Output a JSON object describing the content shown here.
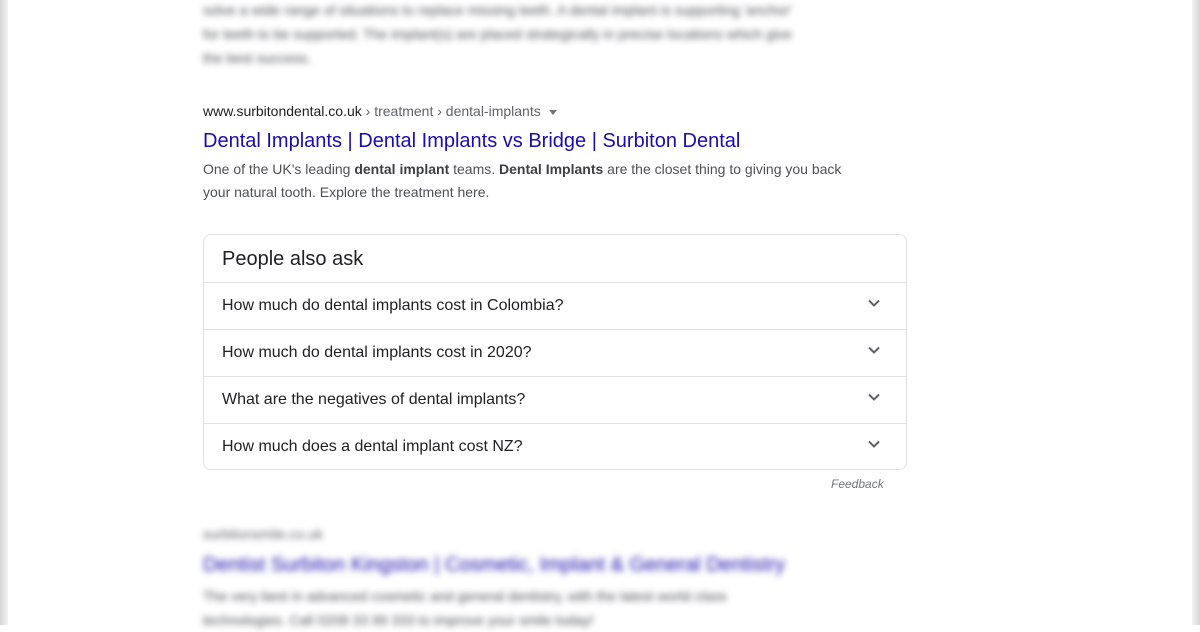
{
  "top_snippet": {
    "line1": "solve a wide range of situations to replace missing teeth. A dental implant is supporting 'anchor'",
    "line2": "for teeth to be supported. The implant(s) are placed strategically in precise locations which give",
    "line3": "the best success."
  },
  "result": {
    "domain": "www.surbitondental.co.uk",
    "crumbs": " › treatment › dental-implants",
    "title": "Dental Implants | Dental Implants vs Bridge | Surbiton Dental",
    "snippet_1": "One of the UK's leading ",
    "snippet_b1": "dental implant",
    "snippet_2": " teams. ",
    "snippet_b2": "Dental Implants",
    "snippet_3": " are the closet thing to giving you back your natural tooth. Explore the treatment here."
  },
  "people_also_ask": {
    "heading": "People also ask",
    "questions": [
      "How much do dental implants cost in Colombia?",
      "How much do dental implants cost in 2020?",
      "What are the negatives of dental implants?",
      "How much does a dental implant cost NZ?"
    ],
    "feedback": "Feedback"
  },
  "bottom_result": {
    "cite": "surbitonsmile.co.uk",
    "title": "Dentist Surbiton Kingston | Cosmetic, Implant & General Dentistry",
    "snippet_line1": "The very best in advanced cosmetic and general dentistry, with the latest world class",
    "snippet_line2": "technologies. Call 0208 33 99 333 to improve your smile today!"
  },
  "colors": {
    "link": "#1a0dab",
    "text": "#202124",
    "snippet": "#4d5156",
    "border": "#dfe1e5"
  },
  "icons": [
    "chevron-down-icon",
    "caret-down-icon"
  ]
}
